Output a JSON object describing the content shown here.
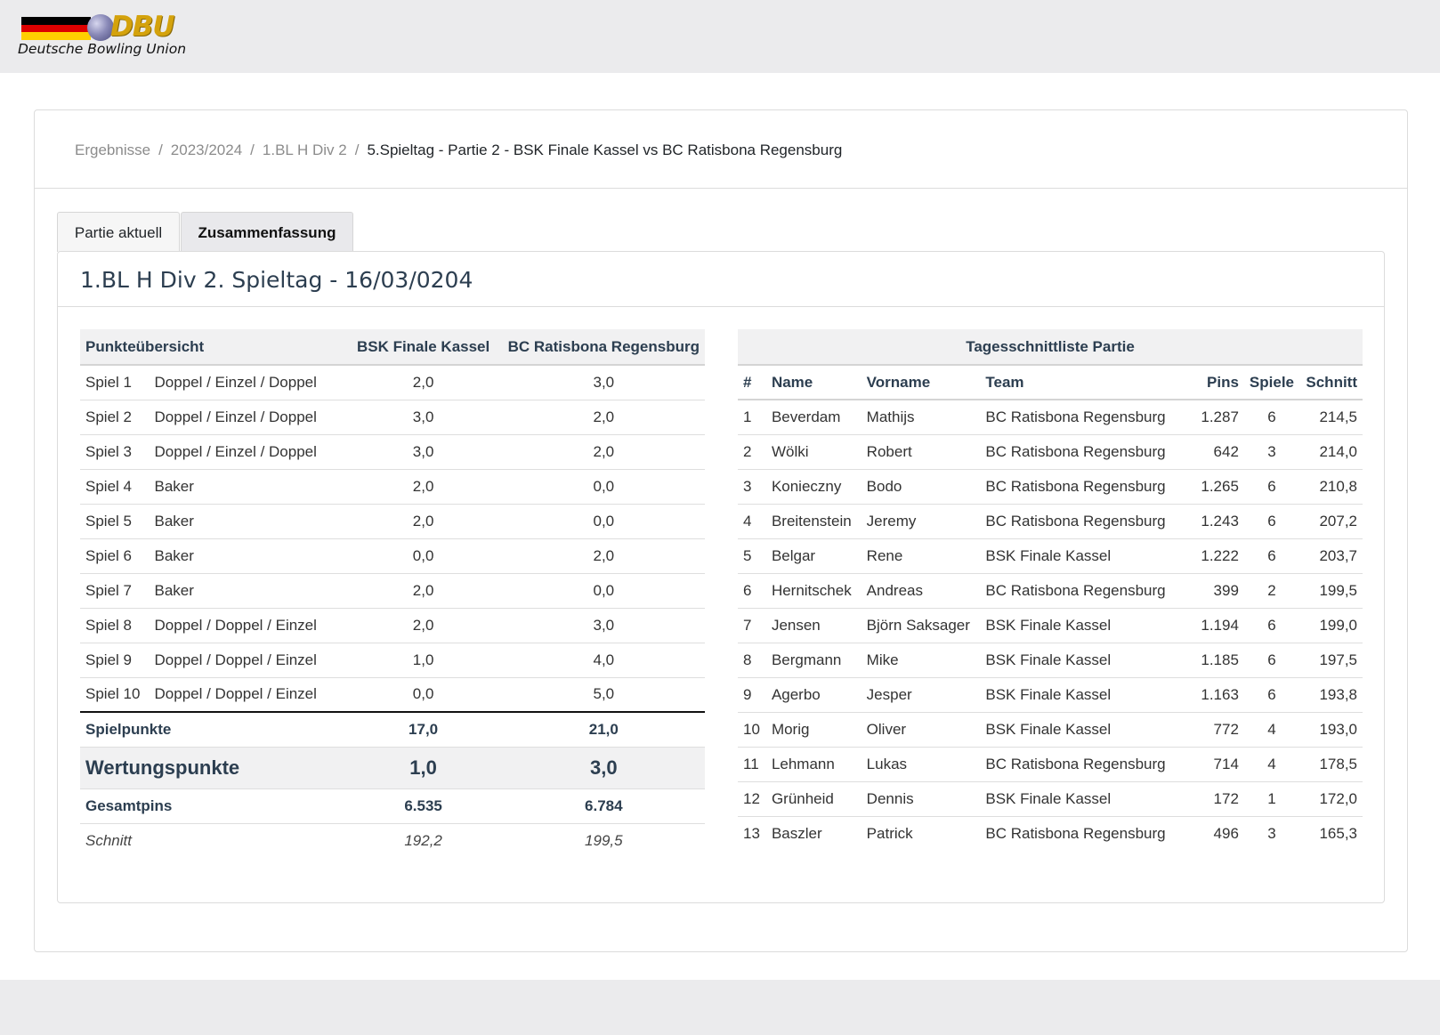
{
  "brand": {
    "mark": "DBU",
    "tagline": "Deutsche Bowling Union",
    "flag_colors": [
      "#000000",
      "#dd0000",
      "#ffce00"
    ]
  },
  "breadcrumb": [
    {
      "label": "Ergebnisse"
    },
    {
      "label": "2023/2024"
    },
    {
      "label": "1.BL H Div 2"
    }
  ],
  "breadcrumb_active": "5.Spieltag - Partie 2 - BSK Finale Kassel vs BC Ratisbona Regensburg",
  "tabs": [
    {
      "label": "Partie aktuell",
      "active": false
    },
    {
      "label": "Zusammenfassung",
      "active": true
    }
  ],
  "panel_title": "1.BL H Div 2. Spieltag - 16/03/0204",
  "points_table": {
    "headers": {
      "overview": "Punkteübersicht",
      "team_a": "BSK Finale Kassel",
      "team_b": "BC Ratisbona Regensburg"
    },
    "games": [
      {
        "game": "Spiel 1",
        "type": "Doppel / Einzel / Doppel",
        "a": "2,0",
        "b": "3,0"
      },
      {
        "game": "Spiel 2",
        "type": "Doppel / Einzel / Doppel",
        "a": "3,0",
        "b": "2,0"
      },
      {
        "game": "Spiel 3",
        "type": "Doppel / Einzel / Doppel",
        "a": "3,0",
        "b": "2,0"
      },
      {
        "game": "Spiel 4",
        "type": "Baker",
        "a": "2,0",
        "b": "0,0"
      },
      {
        "game": "Spiel 5",
        "type": "Baker",
        "a": "2,0",
        "b": "0,0"
      },
      {
        "game": "Spiel 6",
        "type": "Baker",
        "a": "0,0",
        "b": "2,0"
      },
      {
        "game": "Spiel 7",
        "type": "Baker",
        "a": "2,0",
        "b": "0,0"
      },
      {
        "game": "Spiel 8",
        "type": "Doppel / Doppel / Einzel",
        "a": "2,0",
        "b": "3,0"
      },
      {
        "game": "Spiel 9",
        "type": "Doppel / Doppel / Einzel",
        "a": "1,0",
        "b": "4,0"
      },
      {
        "game": "Spiel 10",
        "type": "Doppel / Doppel / Einzel",
        "a": "0,0",
        "b": "5,0"
      }
    ],
    "spielpunkte": {
      "label": "Spielpunkte",
      "a": "17,0",
      "b": "21,0"
    },
    "wertungspunkte": {
      "label": "Wertungspunkte",
      "a": "1,0",
      "b": "3,0"
    },
    "gesamtpins": {
      "label": "Gesamtpins",
      "a": "6.535",
      "b": "6.784"
    },
    "schnitt": {
      "label": "Schnitt",
      "a": "192,2",
      "b": "199,5"
    }
  },
  "avg_table": {
    "caption": "Tagesschnittliste Partie",
    "headers": {
      "rank": "#",
      "name": "Name",
      "first": "Vorname",
      "team": "Team",
      "pins": "Pins",
      "games": "Spiele",
      "avg": "Schnitt"
    },
    "rows": [
      {
        "rank": "1",
        "name": "Beverdam",
        "first": "Mathijs",
        "team": "BC Ratisbona Regensburg",
        "pins": "1.287",
        "games": "6",
        "avg": "214,5"
      },
      {
        "rank": "2",
        "name": "Wölki",
        "first": "Robert",
        "team": "BC Ratisbona Regensburg",
        "pins": "642",
        "games": "3",
        "avg": "214,0"
      },
      {
        "rank": "3",
        "name": "Konieczny",
        "first": "Bodo",
        "team": "BC Ratisbona Regensburg",
        "pins": "1.265",
        "games": "6",
        "avg": "210,8"
      },
      {
        "rank": "4",
        "name": "Breitenstein",
        "first": "Jeremy",
        "team": "BC Ratisbona Regensburg",
        "pins": "1.243",
        "games": "6",
        "avg": "207,2"
      },
      {
        "rank": "5",
        "name": "Belgar",
        "first": "Rene",
        "team": "BSK Finale Kassel",
        "pins": "1.222",
        "games": "6",
        "avg": "203,7"
      },
      {
        "rank": "6",
        "name": "Hernitschek",
        "first": "Andreas",
        "team": "BC Ratisbona Regensburg",
        "pins": "399",
        "games": "2",
        "avg": "199,5"
      },
      {
        "rank": "7",
        "name": "Jensen",
        "first": "Björn Saksager",
        "team": "BSK Finale Kassel",
        "pins": "1.194",
        "games": "6",
        "avg": "199,0"
      },
      {
        "rank": "8",
        "name": "Bergmann",
        "first": "Mike",
        "team": "BSK Finale Kassel",
        "pins": "1.185",
        "games": "6",
        "avg": "197,5"
      },
      {
        "rank": "9",
        "name": "Agerbo",
        "first": "Jesper",
        "team": "BSK Finale Kassel",
        "pins": "1.163",
        "games": "6",
        "avg": "193,8"
      },
      {
        "rank": "10",
        "name": "Morig",
        "first": "Oliver",
        "team": "BSK Finale Kassel",
        "pins": "772",
        "games": "4",
        "avg": "193,0"
      },
      {
        "rank": "11",
        "name": "Lehmann",
        "first": "Lukas",
        "team": "BC Ratisbona Regensburg",
        "pins": "714",
        "games": "4",
        "avg": "178,5"
      },
      {
        "rank": "12",
        "name": "Grünheid",
        "first": "Dennis",
        "team": "BSK Finale Kassel",
        "pins": "172",
        "games": "1",
        "avg": "172,0"
      },
      {
        "rank": "13",
        "name": "Baszler",
        "first": "Patrick",
        "team": "BC Ratisbona Regensburg",
        "pins": "496",
        "games": "3",
        "avg": "165,3"
      }
    ]
  }
}
